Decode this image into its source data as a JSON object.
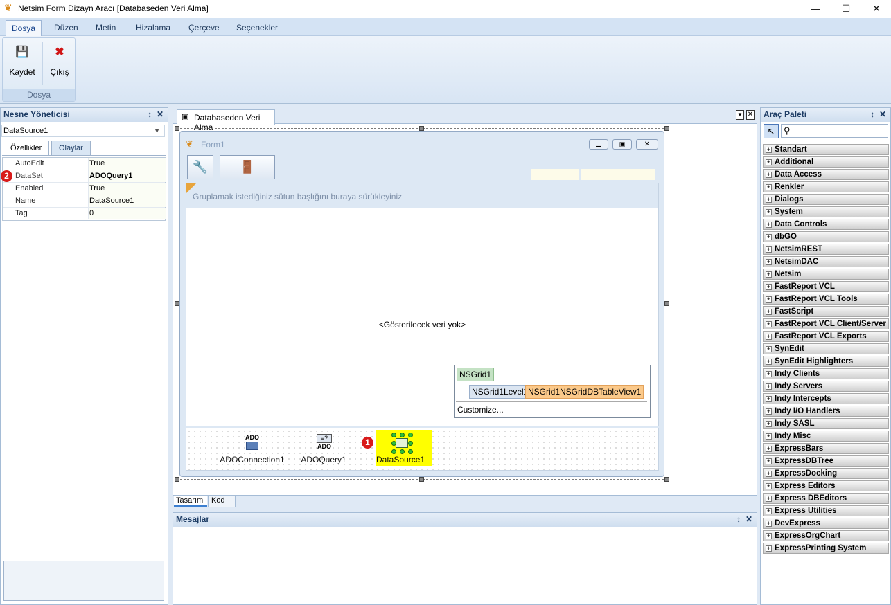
{
  "window": {
    "title": "Netsim Form Dizayn Aracı [Databaseden Veri Alma]"
  },
  "ribbon": {
    "tabs": [
      "Dosya",
      "Düzen",
      "Metin",
      "Hizalama",
      "Çerçeve",
      "Seçenekler"
    ],
    "active_tab": "Dosya",
    "group_label": "Dosya",
    "save_label": "Kaydet",
    "exit_label": "Çıkış"
  },
  "object_inspector": {
    "title": "Nesne Yöneticisi",
    "selected_object": "DataSource1",
    "tabs": [
      "Özellikler",
      "Olaylar"
    ],
    "properties": [
      {
        "name": "AutoEdit",
        "value": "True"
      },
      {
        "name": "DataSet",
        "value": "ADOQuery1"
      },
      {
        "name": "Enabled",
        "value": "True"
      },
      {
        "name": "Name",
        "value": "DataSource1"
      },
      {
        "name": "Tag",
        "value": "0"
      }
    ],
    "badge": "2"
  },
  "designer": {
    "doc_tab": "Databaseden Veri Alma",
    "form_caption": "Form1",
    "group_hint": "Gruplamak istediğiniz sütun başlığını buraya sürükleyiniz",
    "empty_text": "<Gösterilecek veri yok>",
    "grid_popup": {
      "root": "NSGrid1",
      "level": "NSGrid1Level1",
      "view": "NSGrid1NSGridDBTableView1",
      "customize": "Customize..."
    },
    "components": [
      {
        "label": "ADOConnection1",
        "icon": "ADO"
      },
      {
        "label": "ADOQuery1",
        "icon": "ADO"
      },
      {
        "label": "DataSource1",
        "icon": ""
      }
    ],
    "badge": "1",
    "bottom_tabs": [
      "Tasarım",
      "Kod"
    ]
  },
  "messages": {
    "title": "Mesajlar"
  },
  "palette": {
    "title": "Araç Paleti",
    "categories": [
      "Standart",
      "Additional",
      "Data Access",
      "Renkler",
      "Dialogs",
      "System",
      "Data Controls",
      "dbGO",
      "NetsimREST",
      "NetsimDAC",
      "Netsim",
      "FastReport VCL",
      "FastReport VCL Tools",
      "FastScript",
      "FastReport VCL Client/Server",
      "FastReport VCL Exports",
      "SynEdit",
      "SynEdit Highlighters",
      "Indy Clients",
      "Indy Servers",
      "Indy Intercepts",
      "Indy I/O Handlers",
      "Indy SASL",
      "Indy Misc",
      "ExpressBars",
      "ExpressDBTree",
      "ExpressDocking",
      "Express Editors",
      "Express DBEditors",
      "Express Utilities",
      "DevExpress",
      "ExpressOrgChart",
      "ExpressPrinting System"
    ]
  }
}
